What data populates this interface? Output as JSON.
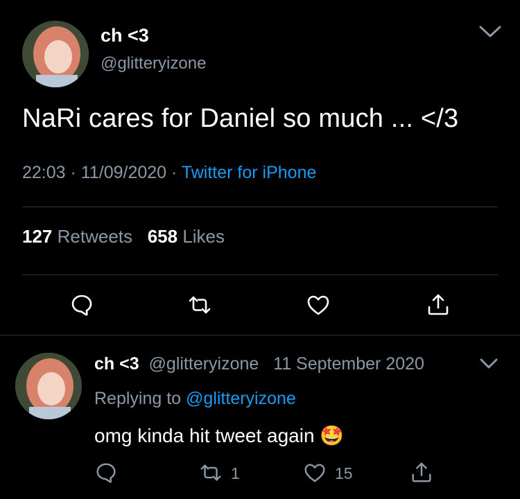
{
  "main_tweet": {
    "display_name": "ch <3",
    "handle": "@glitteryizone",
    "text": "NaRi cares for Daniel so much ... </3",
    "time": "22:03",
    "sep1": "·",
    "date": "11/09/2020",
    "sep2": "·",
    "source": "Twitter for iPhone",
    "retweets_count": "127",
    "retweets_label": "Retweets",
    "likes_count": "658",
    "likes_label": "Likes"
  },
  "reply": {
    "display_name": "ch <3",
    "handle": "@glitteryizone",
    "date": "11 September 2020",
    "replying_prefix": "Replying to",
    "replying_mention": "@glitteryizone",
    "text": "omg kinda hit tweet again",
    "emoji": "🤩",
    "retweet_count": "1",
    "like_count": "15"
  },
  "icons": {
    "more": "chevron-down-icon",
    "reply": "reply-icon",
    "retweet": "retweet-icon",
    "like": "heart-icon",
    "share": "share-icon"
  },
  "colors": {
    "background": "#000000",
    "link": "#1d9bf0",
    "secondary_text": "#8b98a5",
    "divider": "#2f3336"
  }
}
